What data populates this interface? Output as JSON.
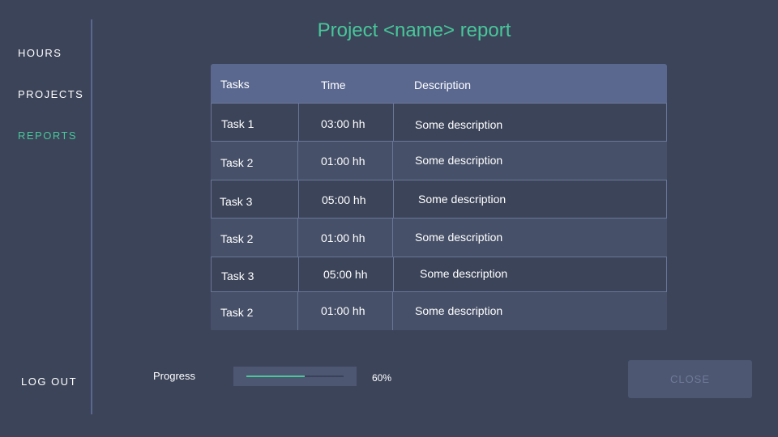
{
  "sidebar": {
    "items": [
      {
        "label": "HOURS"
      },
      {
        "label": "PROJECTS"
      },
      {
        "label": "REPORTS"
      }
    ],
    "logout_label": "LOG OUT"
  },
  "page": {
    "title": "Project <name> report"
  },
  "table": {
    "headers": [
      "Tasks",
      "Time",
      "Description"
    ],
    "rows": [
      {
        "task": "Task 1",
        "time": "03:00 hh",
        "description": "Some description"
      },
      {
        "task": "Task 2",
        "time": "01:00 hh",
        "description": "Some description"
      },
      {
        "task": "Task 3",
        "time": "05:00 hh",
        "description": "Some description"
      },
      {
        "task": "Task 2",
        "time": "01:00 hh",
        "description": "Some description"
      },
      {
        "task": "Task 3",
        "time": "05:00 hh",
        "description": "Some description"
      },
      {
        "task": "Task 2",
        "time": "01:00 hh",
        "description": "Some description"
      }
    ]
  },
  "progress": {
    "label": "Progress",
    "value": 0.6,
    "value_text": "60%"
  },
  "actions": {
    "close_label": "CLOSE"
  },
  "colors": {
    "background": "#3c4459",
    "accent": "#48c79a",
    "header": "#5a6890",
    "row_alt": "#465068"
  }
}
